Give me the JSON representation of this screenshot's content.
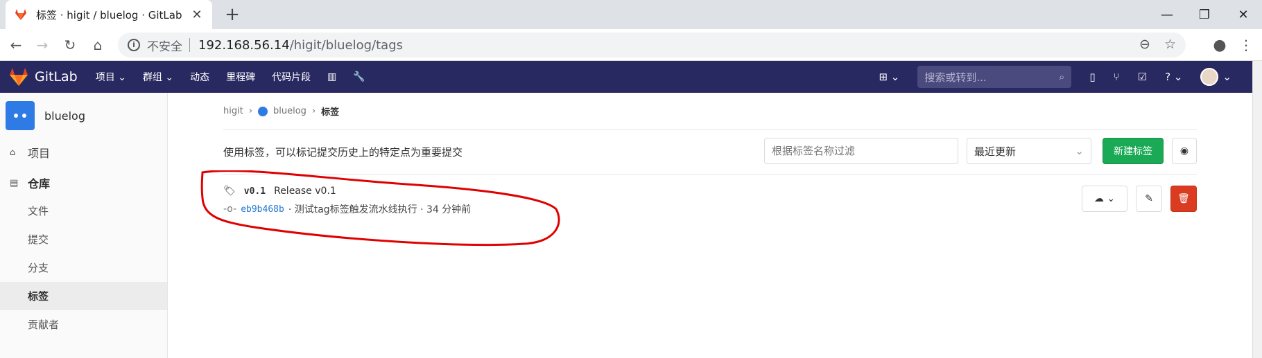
{
  "browser": {
    "tab_title": "标签 · higit / bluelog · GitLab",
    "url_security": "不安全",
    "url_host": "192.168.56.14",
    "url_path": "/higit/bluelog/tags"
  },
  "gitlab": {
    "brand": "GitLab",
    "menu": [
      "项目",
      "群组",
      "动态",
      "里程碑",
      "代码片段"
    ],
    "search_placeholder": "搜索或转到..."
  },
  "sidebar": {
    "project_name": "bluelog",
    "items": {
      "project": "项目",
      "repository": "仓库",
      "files": "文件",
      "commits": "提交",
      "branches": "分支",
      "tags": "标签",
      "contributors": "贡献者"
    }
  },
  "breadcrumb": {
    "group": "higit",
    "project": "bluelog",
    "current": "标签"
  },
  "tags_page": {
    "description": "使用标签，可以标记提交历史上的特定点为重要提交",
    "filter_placeholder": "根据标签名称过滤",
    "sort_value": "最近更新",
    "new_tag_label": "新建标签"
  },
  "tags": [
    {
      "name": "v0.1",
      "release": "Release v0.1",
      "sha": "eb9b468b",
      "message": "· 测试tag标签触发流水线执行 · 34 分钟前"
    }
  ],
  "colors": {
    "navbar": "#292961",
    "accent_green": "#1aaa55",
    "danger": "#db3b21",
    "annotation": "#e00000"
  }
}
